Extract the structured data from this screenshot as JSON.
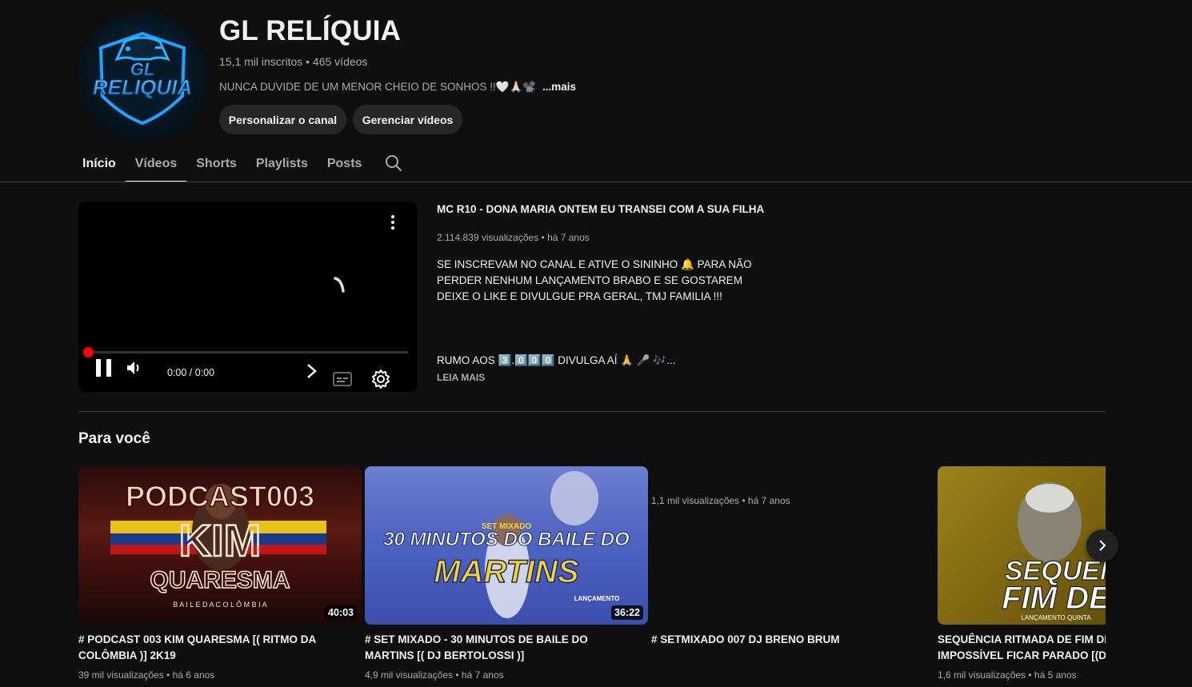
{
  "channel": {
    "name": "GL RELÍQUIA",
    "logo_text_top": "GL",
    "logo_text_bottom": "RELIQUIA",
    "meta": "15,1 mil inscritos • 465 vídeos",
    "description": "NUNCA DUVIDE DE UM MENOR CHEIO DE SONHOS !!🤍🙏🏻📽️",
    "more_label": "...mais",
    "customize_label": "Personalizar o canal",
    "manage_label": "Gerenciar vídeos"
  },
  "tabs": [
    {
      "label": "Início"
    },
    {
      "label": "Vídeos"
    },
    {
      "label": "Shorts"
    },
    {
      "label": "Playlists"
    },
    {
      "label": "Posts"
    }
  ],
  "featured": {
    "title": "MC R10 - DONA MARIA ONTEM EU TRANSEI COM A SUA FILHA",
    "meta": "2.114.839 visualizações • há 7 anos",
    "description_lines": [
      "SE INSCREVAM NO CANAL E ATIVE O SININHO 🔔 PARA NÃO",
      "PERDER NENHUM LANÇAMENTO BRABO E SE GOSTAREM",
      "DEIXE O LIKE E DIVULGUE PRA GERAL, TMJ FAMILIA  !!!"
    ],
    "description_tail": "RUMO AOS 3️⃣.0️⃣0️⃣0️⃣ DIVULGA AÍ 🙏 🎤 🎶...",
    "read_more": "LEIA MAIS",
    "player": {
      "time": "0:00 / 0:00",
      "progress": 0
    }
  },
  "section": {
    "title": "Para você"
  },
  "videos": [
    {
      "title": "# PODCAST 003 KIM QUARESMA [( RITMO DA COLÔMBIA )] 2K19",
      "meta": "39 mil visualizações • há 6 anos",
      "duration": "40:03",
      "thumb_text_1": "PODCAST003",
      "thumb_text_2": "KIM",
      "thumb_text_3": "QUARESMA",
      "thumb_text_4": "B A I L E   D A   C O L Ô M B I A"
    },
    {
      "title": "# SET MIXADO - 30 MINUTOS DE BAILE DO MARTINS [( DJ BERTOLOSSI )]",
      "meta": "4,9 mil visualizações • há 7 anos",
      "duration": "36:22",
      "thumb_text_1": "SET MIXADO",
      "thumb_text_2": "30 MINUTOS DO BAILE DO",
      "thumb_text_3": "MARTINS",
      "thumb_text_4": "LANÇAMENTO"
    },
    {
      "title": "# SETMIXADO 007 DJ BRENO BRUM",
      "meta": "1,1 mil visualizações • há 7 anos",
      "duration": ""
    },
    {
      "title": "SEQUÊNCIA RITMADA DE FIM DE ANO - IMPOSSÍVEL FICAR PARADO [(DJ",
      "meta": "1,6 mil visualizações • há 5 anos",
      "duration": "",
      "thumb_text_1": "SEQUENC",
      "thumb_text_2": "FIM DE",
      "thumb_text_3": "LANÇAMENTO QUINTA"
    }
  ],
  "colors": {
    "background": "#0f0f0f",
    "accent_red": "#ff0000",
    "logo_blue": "#1fa3ff"
  }
}
